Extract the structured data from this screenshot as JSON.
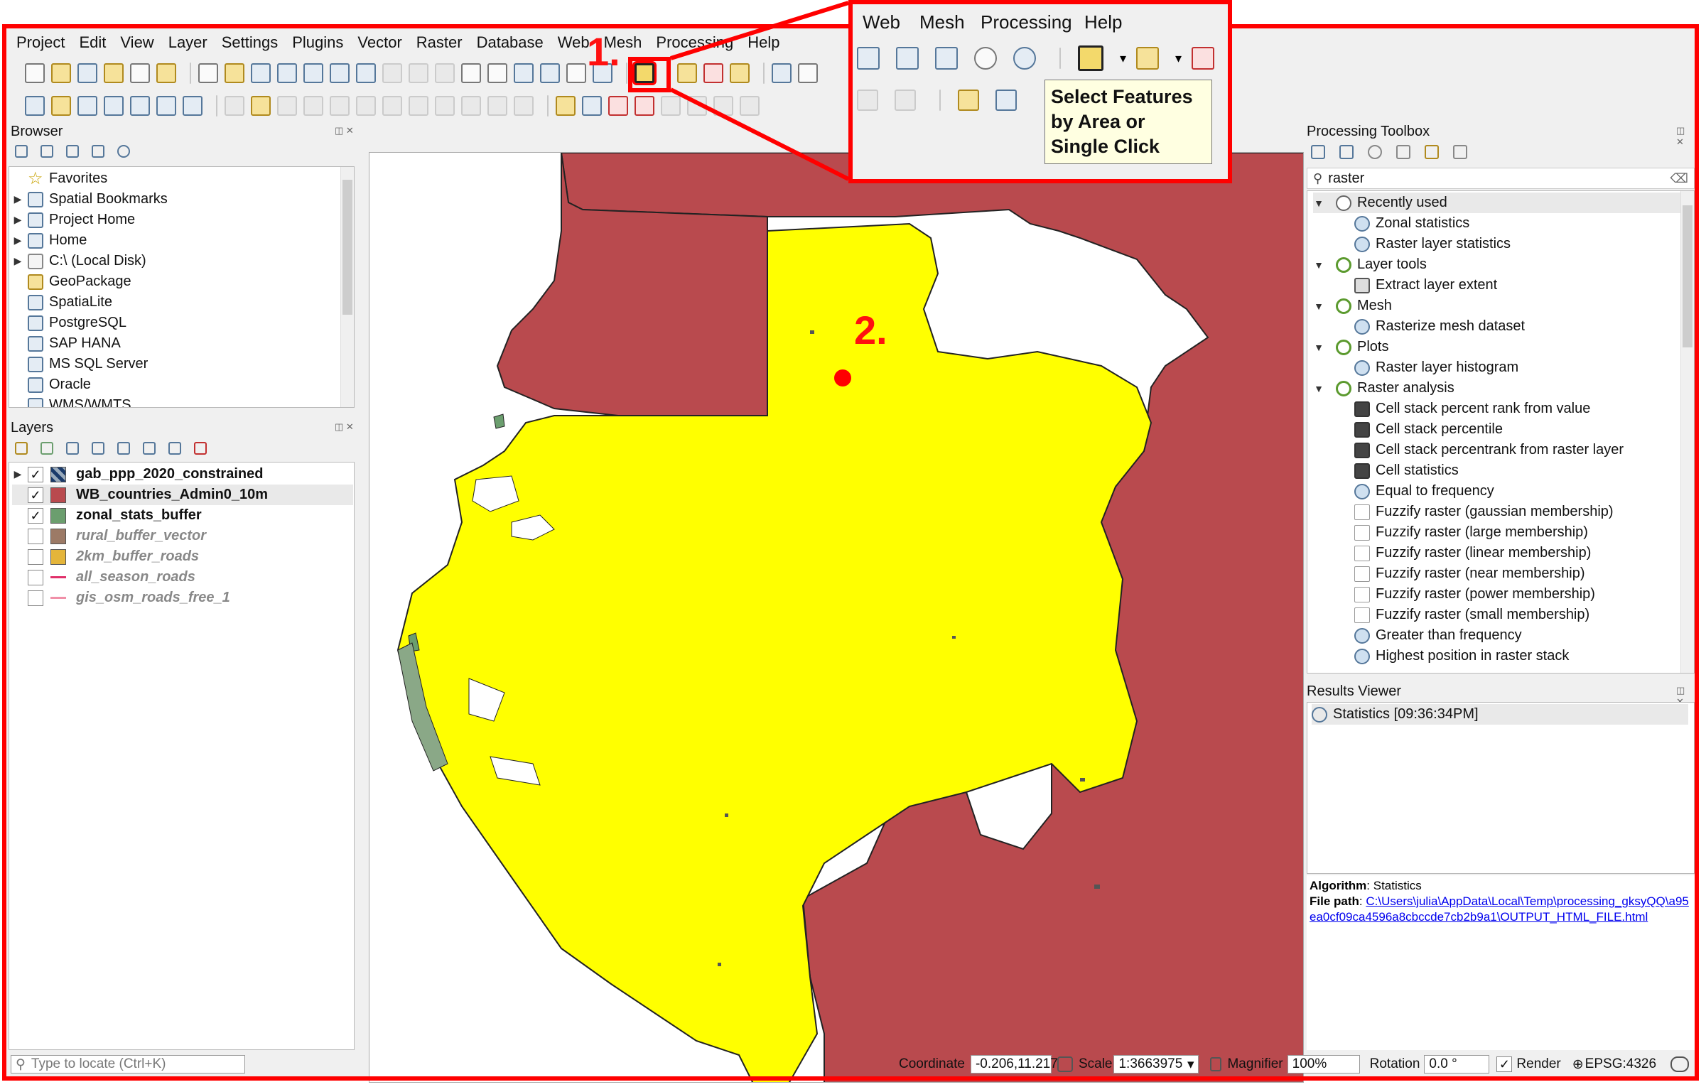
{
  "menu": [
    "Project",
    "Edit",
    "View",
    "Layer",
    "Settings",
    "Plugins",
    "Vector",
    "Raster",
    "Database",
    "Web",
    "Mesh",
    "Processing",
    "Help"
  ],
  "browser": {
    "title": "Browser",
    "items": [
      {
        "label": "Favorites",
        "icon": "star-icon",
        "expand": false
      },
      {
        "label": "Spatial Bookmarks",
        "icon": "bookmark-icon",
        "expand": true
      },
      {
        "label": "Project Home",
        "icon": "project-home-icon",
        "expand": true
      },
      {
        "label": "Home",
        "icon": "home-icon",
        "expand": true
      },
      {
        "label": "C:\\ (Local Disk)",
        "icon": "folder-icon",
        "expand": true
      },
      {
        "label": "GeoPackage",
        "icon": "geopackage-icon",
        "expand": false
      },
      {
        "label": "SpatiaLite",
        "icon": "spatialite-icon",
        "expand": false
      },
      {
        "label": "PostgreSQL",
        "icon": "postgresql-icon",
        "expand": false
      },
      {
        "label": "SAP HANA",
        "icon": "sap-hana-icon",
        "expand": false
      },
      {
        "label": "MS SQL Server",
        "icon": "mssql-icon",
        "expand": false
      },
      {
        "label": "Oracle",
        "icon": "oracle-icon",
        "expand": false
      },
      {
        "label": "WMS/WMTS",
        "icon": "wms-icon",
        "expand": false
      }
    ]
  },
  "layers": {
    "title": "Layers",
    "items": [
      {
        "label": "gab_ppp_2020_constrained",
        "checked": true,
        "swatch": "raster",
        "style": "bold",
        "expand": true
      },
      {
        "label": "WB_countries_Admin0_10m",
        "checked": true,
        "swatch": "#b94a4e",
        "style": "bold",
        "expand": false
      },
      {
        "label": "zonal_stats_buffer",
        "checked": true,
        "swatch": "#6b9e6e",
        "style": "bold",
        "expand": false
      },
      {
        "label": "rural_buffer_vector",
        "checked": false,
        "swatch": "#9c7a66",
        "style": "grey",
        "expand": false
      },
      {
        "label": "2km_buffer_roads",
        "checked": false,
        "swatch": "#e4b53a",
        "style": "grey",
        "expand": false
      },
      {
        "label": "all_season_roads",
        "checked": false,
        "swatch": "line:#e0306a",
        "style": "grey",
        "expand": false
      },
      {
        "label": "gis_osm_roads_free_1",
        "checked": false,
        "swatch": "line:#f090a8",
        "style": "grey",
        "expand": false
      }
    ]
  },
  "toolbox": {
    "title": "Processing Toolbox",
    "search": "raster",
    "items": [
      {
        "label": "Recently used",
        "level": 0,
        "icon": "clock-icon"
      },
      {
        "label": "Zonal statistics",
        "level": 1,
        "icon": "gear-icon"
      },
      {
        "label": "Raster layer statistics",
        "level": 1,
        "icon": "gear-icon"
      },
      {
        "label": "Layer tools",
        "level": 0,
        "icon": "qgis-icon"
      },
      {
        "label": "Extract layer extent",
        "level": 1,
        "icon": "extent-icon"
      },
      {
        "label": "Mesh",
        "level": 0,
        "icon": "qgis-icon"
      },
      {
        "label": "Rasterize mesh dataset",
        "level": 1,
        "icon": "gear-icon"
      },
      {
        "label": "Plots",
        "level": 0,
        "icon": "qgis-icon"
      },
      {
        "label": "Raster layer histogram",
        "level": 1,
        "icon": "gear-icon"
      },
      {
        "label": "Raster analysis",
        "level": 0,
        "icon": "qgis-icon"
      },
      {
        "label": "Cell stack percent rank from value",
        "level": 1,
        "icon": "percent-icon"
      },
      {
        "label": "Cell stack percentile",
        "level": 1,
        "icon": "percent-icon"
      },
      {
        "label": "Cell stack percentrank from raster layer",
        "level": 1,
        "icon": "percent-icon"
      },
      {
        "label": "Cell statistics",
        "level": 1,
        "icon": "sigma-icon"
      },
      {
        "label": "Equal to frequency",
        "level": 1,
        "icon": "gear-icon"
      },
      {
        "label": "Fuzzify raster (gaussian membership)",
        "level": 1,
        "icon": "fuzzy-icon"
      },
      {
        "label": "Fuzzify raster (large membership)",
        "level": 1,
        "icon": "fuzzy-icon"
      },
      {
        "label": "Fuzzify raster (linear membership)",
        "level": 1,
        "icon": "fuzzy-icon"
      },
      {
        "label": "Fuzzify raster (near membership)",
        "level": 1,
        "icon": "fuzzy-icon"
      },
      {
        "label": "Fuzzify raster (power membership)",
        "level": 1,
        "icon": "fuzzy-icon"
      },
      {
        "label": "Fuzzify raster (small membership)",
        "level": 1,
        "icon": "fuzzy-icon"
      },
      {
        "label": "Greater than frequency",
        "level": 1,
        "icon": "gear-icon"
      },
      {
        "label": "Highest position in raster stack",
        "level": 1,
        "icon": "gear-icon"
      }
    ]
  },
  "results": {
    "title": "Results Viewer",
    "entry": "Statistics [09:36:34PM]",
    "algorithm_label": "Algorithm",
    "algorithm_value": "Statistics",
    "filepath_label": "File path",
    "filepath_value": "C:\\Users\\julia\\AppData\\Local\\Temp\\processing_gksyQQ\\a95ea0cf09ca4596a8cbccde7cb2b9a1\\OUTPUT_HTML_FILE.html"
  },
  "status": {
    "locate_placeholder": "Type to locate (Ctrl+K)",
    "coordinate_label": "Coordinate",
    "coordinate_value": "-0.206,11.217",
    "scale_label": "Scale",
    "scale_value": "1:3663975",
    "magnifier_label": "Magnifier",
    "magnifier_value": "100%",
    "rotation_label": "Rotation",
    "rotation_value": "0.0 °",
    "render_label": "Render",
    "crs": "EPSG:4326"
  },
  "callout": {
    "menu": [
      "Web",
      "Mesh",
      "Processing",
      "Help"
    ],
    "tooltip": "Select Features by Area or Single Click"
  },
  "annotations": {
    "step1": "1.",
    "step2": "2."
  },
  "colors": {
    "country_fill": "#b94a4e",
    "gabon_fill": "#ffff00",
    "highlight": "#ff0000"
  }
}
